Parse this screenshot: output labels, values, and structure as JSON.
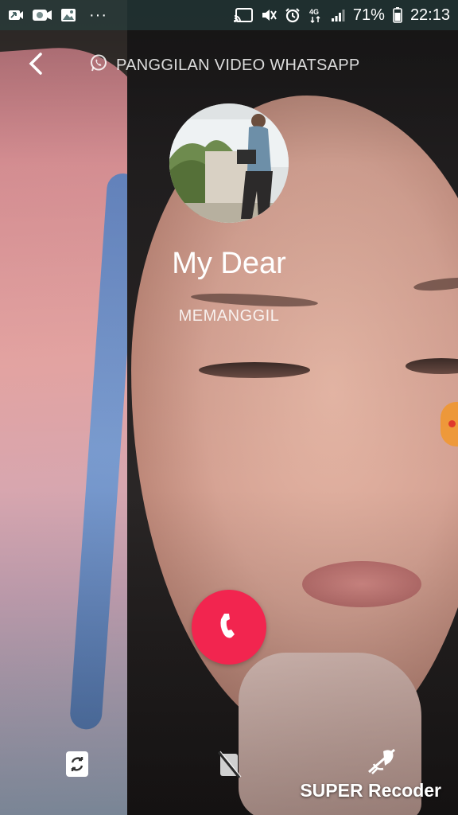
{
  "status_bar": {
    "left_icons": [
      "missed-video-call-icon",
      "video-camera-icon",
      "image-icon"
    ],
    "more": "···",
    "right_icons": [
      "cast-icon",
      "mute-icon",
      "alarm-icon",
      "network-4g-icon",
      "signal-icon"
    ],
    "network": "4G",
    "battery_percent": "71%",
    "time": "22:13"
  },
  "header": {
    "back_icon": "chevron-left-icon",
    "call_type": "PANGGILAN VIDEO WHATSAPP",
    "whatsapp_icon": "whatsapp-icon"
  },
  "contact": {
    "name": "My Dear",
    "status": "MEMANGGIL"
  },
  "controls": {
    "end_call_icon": "phone-hangup-icon",
    "switch_camera_icon": "switch-camera-icon",
    "video_off_icon": "video-off-icon",
    "mute_icon": "mic-off-icon"
  },
  "watermark": "SUPER Recoder",
  "colors": {
    "end_call": "#f2254f",
    "status_bar": "#284646"
  }
}
